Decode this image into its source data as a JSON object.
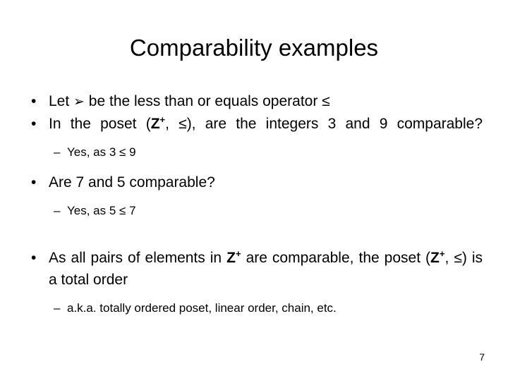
{
  "slide": {
    "title": "Comparability examples",
    "page_number": "7",
    "background_color": "#ffffff",
    "text_color": "#000000"
  },
  "content": {
    "bullet1": {
      "prefix": "Let ",
      "symbol": "➢",
      "symbol_name": "wingdings-arrow-glyph",
      "suffix": " be the less than or equals operator ≤"
    },
    "bullet2": {
      "part1": "In the poset (",
      "set": "Z",
      "set_superscript": "+",
      "part2": ", ≤), are the integers 3 and 9 comparable?"
    },
    "subbullet2": {
      "dash": "–",
      "text": "Yes, as 3 ≤ 9"
    },
    "bullet3": {
      "text": "Are 7 and 5 comparable?"
    },
    "subbullet3": {
      "dash": "–",
      "text": "Yes, as 5 ≤ 7"
    },
    "bullet4": {
      "part1": "As all pairs of elements in ",
      "set": "Z",
      "set_superscript": "+",
      "part2": " are comparable, the poset (",
      "set2": "Z",
      "set2_superscript": "+",
      "part3": ", ≤) is a total order"
    },
    "subbullet4": {
      "dash": "–",
      "text": "a.k.a. totally ordered poset, linear order, chain, etc."
    },
    "bullet_glyph": "•"
  }
}
